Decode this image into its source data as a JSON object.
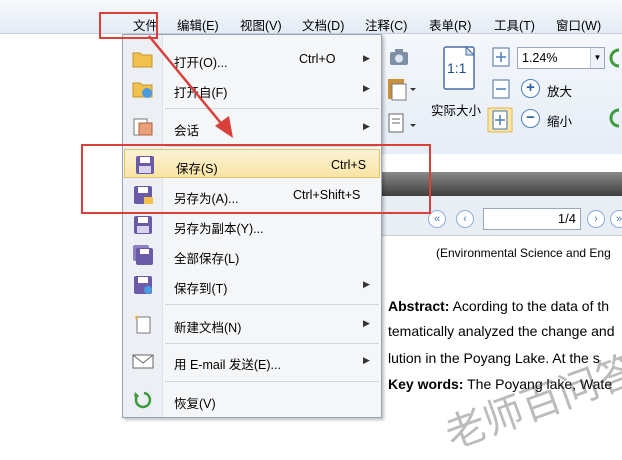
{
  "menubar": {
    "items": [
      "文件",
      "编辑(E)",
      "视图(V)",
      "文档(D)",
      "注释(C)",
      "表单(R)",
      "工具(T)",
      "窗口(W)"
    ]
  },
  "toolbar": {
    "actual_size_label": "实际大小",
    "fit_icon_text": "1:1",
    "zoom_value": "1.24%",
    "zoom_in_label": "放大",
    "zoom_out_label": "缩小"
  },
  "nav": {
    "page_display": "1/4"
  },
  "document": {
    "lines": [
      "(Environmental Science and Eng",
      "Abstract: Acording to the data of th",
      "tematically analyzed the change and",
      "lution in the Poyang Lake. At the s",
      "Key words: The Poyang lake, Wate"
    ]
  },
  "file_menu": {
    "items": [
      {
        "label": "打开(O)...",
        "shortcut": "Ctrl+O",
        "submenu": true
      },
      {
        "label": "打开自(F)",
        "shortcut": "",
        "submenu": true
      },
      {
        "label": "会话",
        "shortcut": "",
        "submenu": true
      },
      {
        "label": "保存(S)",
        "shortcut": "Ctrl+S",
        "submenu": false
      },
      {
        "label": "另存为(A)...",
        "shortcut": "Ctrl+Shift+S",
        "submenu": false
      },
      {
        "label": "另存为副本(Y)...",
        "shortcut": "",
        "submenu": false
      },
      {
        "label": "全部保存(L)",
        "shortcut": "",
        "submenu": false
      },
      {
        "label": "保存到(T)",
        "shortcut": "",
        "submenu": true
      },
      {
        "label": "新建文档(N)",
        "shortcut": "",
        "submenu": true
      },
      {
        "label": "用 E-mail 发送(E)...",
        "shortcut": "",
        "submenu": true
      },
      {
        "label": "恢复(V)",
        "shortcut": "",
        "submenu": false
      }
    ],
    "submenu_arrow": "▶"
  },
  "watermark": "老师百问答",
  "colors": {
    "highlight_red": "#d9403a",
    "menu_hover": "#f9e4a5"
  }
}
